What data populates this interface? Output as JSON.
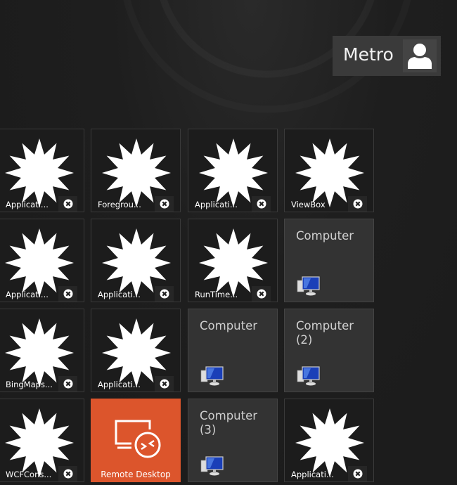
{
  "user": {
    "name": "Metro",
    "avatar_icon": "user-icon"
  },
  "tiles": [
    {
      "type": "app",
      "label": "Applicati..."
    },
    {
      "type": "app",
      "label": "Foregrou..."
    },
    {
      "type": "app",
      "label": "Applicati..."
    },
    {
      "type": "app",
      "label": "ViewBox"
    },
    {
      "type": "app",
      "label": "Applicati..."
    },
    {
      "type": "app",
      "label": "Applicati..."
    },
    {
      "type": "app",
      "label": "RunTime..."
    },
    {
      "type": "computer",
      "label": "Computer"
    },
    {
      "type": "app",
      "label": "BingMaps..."
    },
    {
      "type": "app",
      "label": "Applicati..."
    },
    {
      "type": "computer",
      "label": "Computer"
    },
    {
      "type": "computer",
      "label": "Computer (2)"
    },
    {
      "type": "app",
      "label": "WCFCons..."
    },
    {
      "type": "remote",
      "label": "Remote Desktop"
    },
    {
      "type": "computer",
      "label": "Computer (3)"
    },
    {
      "type": "app",
      "label": "Applicati..."
    }
  ],
  "colors": {
    "accent": "#dc552c",
    "tile": "#1c1c1c",
    "computer_tile": "#333333"
  }
}
